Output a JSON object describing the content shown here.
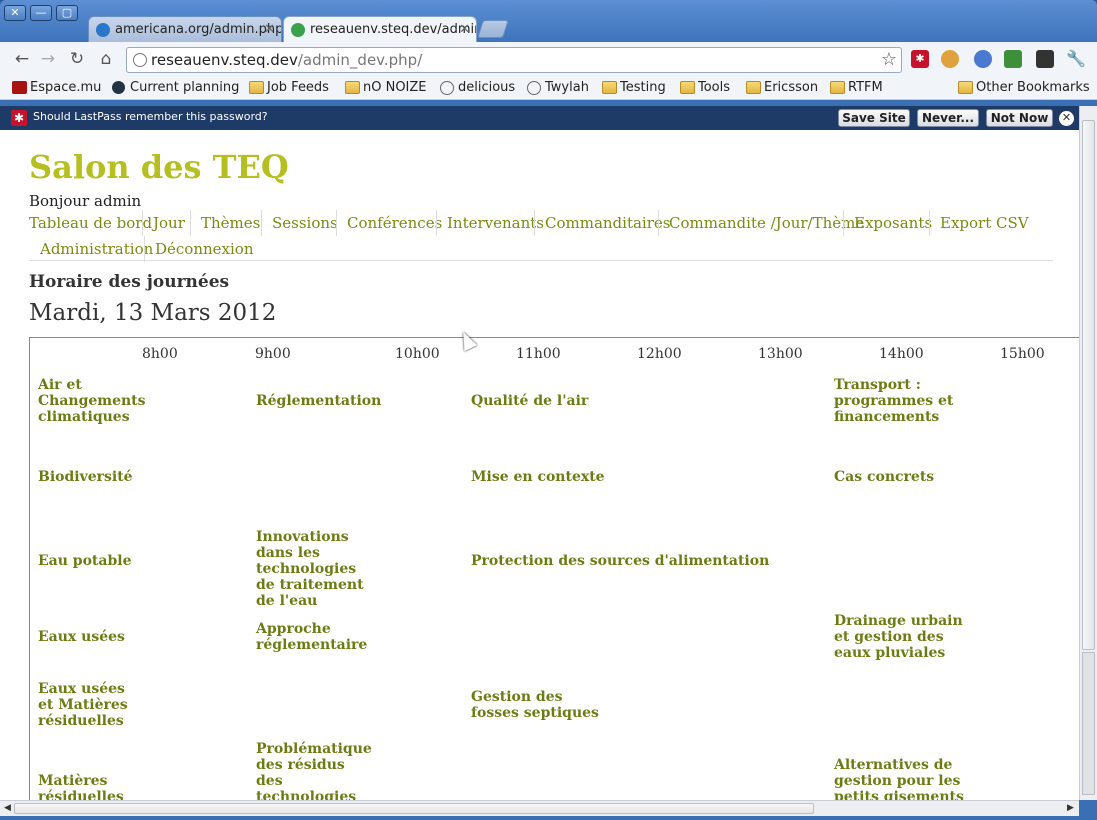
{
  "tabs": [
    {
      "label": "americana.org/admin.php/",
      "active": false
    },
    {
      "label": "reseauenv.steq.dev/admin",
      "active": true
    }
  ],
  "window_controls": {
    "close": "✕",
    "minimize": "—",
    "maximize": "▢"
  },
  "address": {
    "host": "reseauenv.steq.dev",
    "path": "/admin_dev.php/"
  },
  "bookmarks": [
    {
      "label": "Espace.mu",
      "icon": "espace-icon"
    },
    {
      "label": "Current planning",
      "icon": "planning-icon"
    },
    {
      "label": "Job Feeds",
      "icon": "folder-icon"
    },
    {
      "label": "nO NOIZE",
      "icon": "folder-icon"
    },
    {
      "label": "delicious",
      "icon": "globe-icon"
    },
    {
      "label": "Twylah",
      "icon": "globe-icon"
    },
    {
      "label": "Testing",
      "icon": "folder-icon"
    },
    {
      "label": "Tools",
      "icon": "folder-icon"
    },
    {
      "label": "Ericsson",
      "icon": "folder-icon"
    },
    {
      "label": "RTFM",
      "icon": "folder-icon"
    }
  ],
  "other_bookmarks": "Other Bookmarks",
  "lastpass": {
    "message": "Should LastPass remember this password?",
    "save": "Save Site",
    "never": "Never...",
    "not_now": "Not Now"
  },
  "site": {
    "title": "Salon des TEQ",
    "greeting": "Bonjour admin",
    "nav": [
      "Tableau de bord",
      "Jour",
      "Thèmes",
      "Sessions",
      "Conférences",
      "Intervenants",
      "Commanditaires",
      "Commandite /Jour/Thème",
      "Exposants",
      "Export CSV",
      "Administration",
      "Déconnexion"
    ],
    "section_heading": "Horaire des journées",
    "date": "Mardi, 13 Mars 2012"
  },
  "schedule": {
    "hours": [
      "8h00",
      "9h00",
      "10h00",
      "11h00",
      "12h00",
      "13h00",
      "14h00",
      "15h00"
    ],
    "topics": [
      "Air et Changements climatiques",
      "Biodiversité",
      "Eau potable",
      "Eaux usées",
      "Eaux usées et Matières résiduelles",
      "Matières résiduelles"
    ],
    "sessions": {
      "s1": "Réglementation",
      "s2": "Qualité de l'air",
      "s3": "Transport : programmes et financements",
      "s4": "Mise en contexte",
      "s5": "Cas concrets",
      "s6": "Innovations dans les technologies de traitement de l'eau",
      "s7": "Protection des sources d'alimentation",
      "s8": "Approche réglementaire",
      "s9": "Drainage urbain et gestion des eaux pluviales",
      "s10": "Gestion des fosses septiques",
      "s11": "Problématique des résidus des technologies de l'information et",
      "s12": "Alternatives de gestion pour les petits gisements et pour les"
    }
  },
  "colors": {
    "site_title": "#b5bf1f",
    "link": "#7b8a10",
    "session": "#6b7d12",
    "lastpass_bar": "#1e3b68",
    "chrome_blue": "#3b6fb4"
  }
}
